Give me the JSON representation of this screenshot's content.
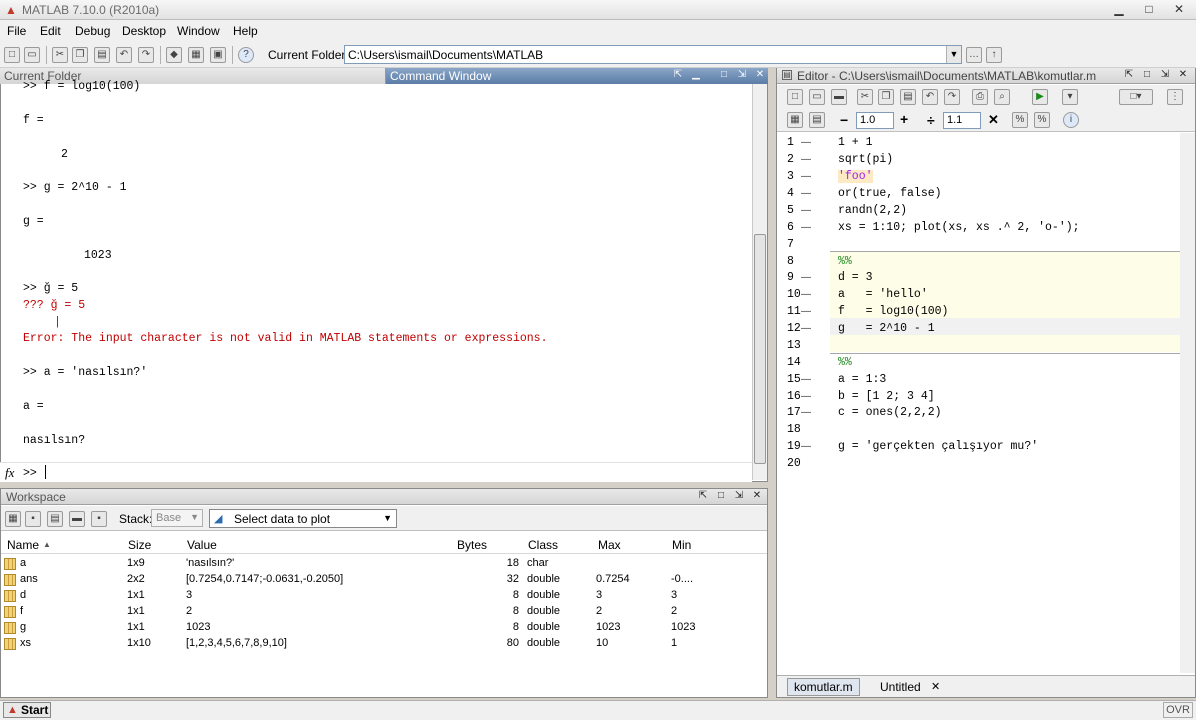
{
  "window": {
    "title": "MATLAB 7.10.0 (R2010a)"
  },
  "menu": [
    "File",
    "Edit",
    "Debug",
    "Desktop",
    "Window",
    "Help"
  ],
  "toolbar": {
    "current_folder_label": "Current Folder:",
    "current_folder_path": "C:\\Users\\ismail\\Documents\\MATLAB"
  },
  "panels": {
    "current_folder_tab": "Current Folder",
    "command_window_tab": "Command Window",
    "workspace_title": "Workspace",
    "editor_title": "Editor - C:\\Users\\ismail\\Documents\\MATLAB\\komutlar.m"
  },
  "command_window": {
    "lines": [
      ">> f = log10(100)",
      "f =",
      "2",
      ">> g = 2^10 - 1",
      "g =",
      "1023",
      ">> ğ = 5",
      "??? ğ = 5",
      "|",
      "Error: The input character is not valid in MATLAB statements or expressions.",
      ">> a = 'nasılsın?'",
      "a =",
      "nasılsın?"
    ],
    "prompt": ">>",
    "fx": "fx"
  },
  "workspace": {
    "stack_label": "Stack:",
    "stack_value": "Base",
    "plot_select": "Select data to plot",
    "columns": [
      "Name",
      "Size",
      "Value",
      "Bytes",
      "Class",
      "Max",
      "Min"
    ],
    "rows": [
      {
        "name": "a",
        "size": "1x9",
        "value": "'nasılsın?'",
        "bytes": "18",
        "class": "char",
        "max": "",
        "min": ""
      },
      {
        "name": "ans",
        "size": "2x2",
        "value": "[0.7254,0.7147;-0.0631,-0.2050]",
        "bytes": "32",
        "class": "double",
        "max": "0.7254",
        "min": "-0...."
      },
      {
        "name": "d",
        "size": "1x1",
        "value": "3",
        "bytes": "8",
        "class": "double",
        "max": "3",
        "min": "3"
      },
      {
        "name": "f",
        "size": "1x1",
        "value": "2",
        "bytes": "8",
        "class": "double",
        "max": "2",
        "min": "2"
      },
      {
        "name": "g",
        "size": "1x1",
        "value": "1023",
        "bytes": "8",
        "class": "double",
        "max": "1023",
        "min": "1023"
      },
      {
        "name": "xs",
        "size": "1x10",
        "value": "[1,2,3,4,5,6,7,8,9,10]",
        "bytes": "80",
        "class": "double",
        "max": "10",
        "min": "1"
      }
    ]
  },
  "editor": {
    "cell_size_a": "1.0",
    "cell_size_b": "1.1",
    "lines": [
      "1 + 1",
      "sqrt(pi)",
      "'foo'",
      "or(true, false)",
      "randn(2,2)",
      "xs = 1:10; plot(xs, xs .^ 2, 'o-');",
      "",
      "%%",
      "d = 3",
      "a   = 'hello'",
      "f   = log10(100)",
      "g   = 2^10 - 1",
      "",
      "%%",
      "a = 1:3",
      "b = [1 2; 3 4]",
      "c = ones(2,2,2)",
      "",
      "g = 'gerçekten çalışıyor mu?'",
      ""
    ],
    "tabs": [
      "komutlar.m",
      "Untitled"
    ]
  },
  "status": {
    "start": "Start",
    "ovr": "OVR"
  }
}
